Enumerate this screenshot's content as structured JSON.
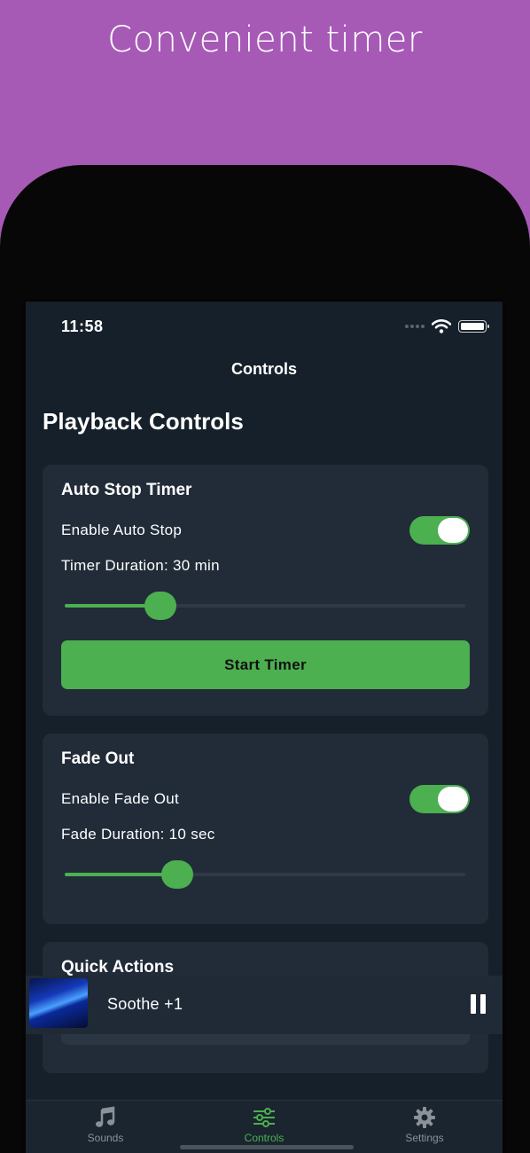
{
  "headline": "Convenient timer",
  "status_bar": {
    "time": "11:58"
  },
  "nav": {
    "title": "Controls"
  },
  "page_title": "Playback Controls",
  "auto_stop": {
    "title": "Auto Stop Timer",
    "enable_label": "Enable Auto Stop",
    "enabled": true,
    "duration_label": "Timer Duration: 30 min",
    "slider_fraction": 0.24,
    "start_button": "Start Timer"
  },
  "fade_out": {
    "title": "Fade Out",
    "enable_label": "Enable Fade Out",
    "enabled": true,
    "duration_label": "Fade Duration: 10 sec",
    "slider_fraction": 0.28
  },
  "quick_actions": {
    "title": "Quick Actions"
  },
  "mini_player": {
    "track": "Soothe +1",
    "state": "playing"
  },
  "tab_bar": {
    "tabs": [
      {
        "label": "Sounds",
        "icon": "music-note-icon",
        "active": false
      },
      {
        "label": "Controls",
        "icon": "sliders-icon",
        "active": true
      },
      {
        "label": "Settings",
        "icon": "gear-icon",
        "active": false
      }
    ]
  },
  "colors": {
    "background_purple": "#a65ab6",
    "screen": "#16202a",
    "card": "#212c38",
    "accent_green": "#4caf50"
  }
}
